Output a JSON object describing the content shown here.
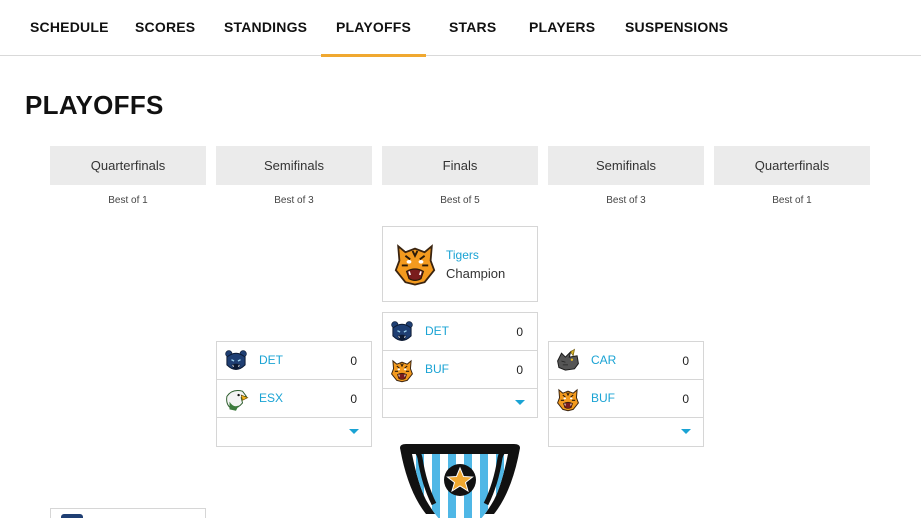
{
  "nav": {
    "items": [
      {
        "label": "SCHEDULE"
      },
      {
        "label": "SCORES"
      },
      {
        "label": "STANDINGS"
      },
      {
        "label": "PLAYOFFS",
        "active": true
      },
      {
        "label": "STARS"
      },
      {
        "label": "PLAYERS"
      },
      {
        "label": "SUSPENSIONS"
      }
    ]
  },
  "page": {
    "title": "PLAYOFFS"
  },
  "rounds": [
    {
      "name": "Quarterfinals",
      "sub": "Best of 1"
    },
    {
      "name": "Semifinals",
      "sub": "Best of 3"
    },
    {
      "name": "Finals",
      "sub": "Best of 5"
    },
    {
      "name": "Semifinals",
      "sub": "Best of 3"
    },
    {
      "name": "Quarterfinals",
      "sub": "Best of 1"
    }
  ],
  "champion": {
    "team": "Tigers",
    "label": "Champion",
    "logo": "tiger-icon"
  },
  "series": {
    "left_semi": {
      "teams": [
        {
          "abbr": "DET",
          "score": "0",
          "logo": "bear-icon"
        },
        {
          "abbr": "ESX",
          "score": "0",
          "logo": "eagle-icon"
        }
      ]
    },
    "finals": {
      "teams": [
        {
          "abbr": "DET",
          "score": "0",
          "logo": "bear-icon"
        },
        {
          "abbr": "BUF",
          "score": "0",
          "logo": "tiger-icon"
        }
      ]
    },
    "right_semi": {
      "teams": [
        {
          "abbr": "CAR",
          "score": "0",
          "logo": "rhino-icon"
        },
        {
          "abbr": "BUF",
          "score": "0",
          "logo": "tiger-icon"
        }
      ]
    }
  },
  "colors": {
    "accent": "#f0a830",
    "link": "#1aa3d4",
    "header_bg": "#ebebeb"
  }
}
